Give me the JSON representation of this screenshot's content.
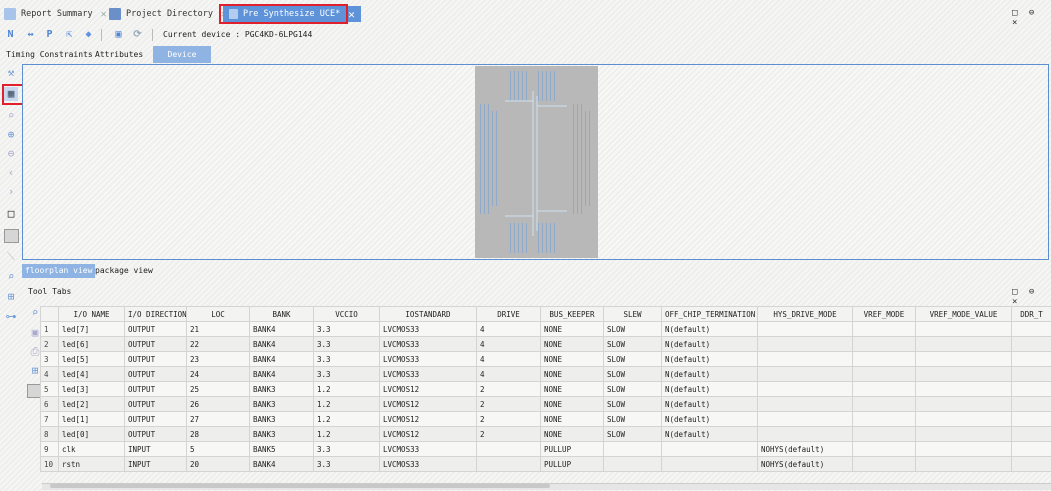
{
  "doc_tabs": [
    {
      "label": "Report Summary",
      "active": false
    },
    {
      "label": "Project Directory",
      "active": false
    },
    {
      "label": "Pre Synthesize UCE*",
      "active": true
    }
  ],
  "window_controls": "□ ⊖ ×",
  "toolbar": {
    "icons": [
      "new-icon",
      "arrow-icon",
      "p-icon",
      "export-icon",
      "diamond-icon",
      "save-icon",
      "refresh-icon"
    ],
    "current_device_label": "Current device : PGC4KD-6LPG144"
  },
  "view_tabs": [
    "Timing Constraints",
    "Attributes",
    "Device"
  ],
  "bottom_tabs": [
    "floorplan view",
    "package view"
  ],
  "tool_tabs_title": "Tool Tabs",
  "table": {
    "columns": [
      "",
      "I/O NAME",
      "I/O DIRECTION",
      "LOC",
      "BANK",
      "VCCIO",
      "IOSTANDARD",
      "DRIVE",
      "BUS_KEEPER",
      "SLEW",
      "OFF_CHIP_TERMINATION",
      "HYS_DRIVE_MODE",
      "VREF_MODE",
      "VREF_MODE_VALUE",
      "DDR_T"
    ],
    "rows": [
      [
        "1",
        "led[7]",
        "OUTPUT",
        "21",
        "BANK4",
        "3.3",
        "LVCMOS33",
        "4",
        "NONE",
        "SLOW",
        "N(default)",
        "",
        "",
        "",
        ""
      ],
      [
        "2",
        "led[6]",
        "OUTPUT",
        "22",
        "BANK4",
        "3.3",
        "LVCMOS33",
        "4",
        "NONE",
        "SLOW",
        "N(default)",
        "",
        "",
        "",
        ""
      ],
      [
        "3",
        "led[5]",
        "OUTPUT",
        "23",
        "BANK4",
        "3.3",
        "LVCMOS33",
        "4",
        "NONE",
        "SLOW",
        "N(default)",
        "",
        "",
        "",
        ""
      ],
      [
        "4",
        "led[4]",
        "OUTPUT",
        "24",
        "BANK4",
        "3.3",
        "LVCMOS33",
        "4",
        "NONE",
        "SLOW",
        "N(default)",
        "",
        "",
        "",
        ""
      ],
      [
        "5",
        "led[3]",
        "OUTPUT",
        "25",
        "BANK3",
        "1.2",
        "LVCMOS12",
        "2",
        "NONE",
        "SLOW",
        "N(default)",
        "",
        "",
        "",
        ""
      ],
      [
        "6",
        "led[2]",
        "OUTPUT",
        "26",
        "BANK3",
        "1.2",
        "LVCMOS12",
        "2",
        "NONE",
        "SLOW",
        "N(default)",
        "",
        "",
        "",
        ""
      ],
      [
        "7",
        "led[1]",
        "OUTPUT",
        "27",
        "BANK3",
        "1.2",
        "LVCMOS12",
        "2",
        "NONE",
        "SLOW",
        "N(default)",
        "",
        "",
        "",
        ""
      ],
      [
        "8",
        "led[0]",
        "OUTPUT",
        "28",
        "BANK3",
        "1.2",
        "LVCMOS12",
        "2",
        "NONE",
        "SLOW",
        "N(default)",
        "",
        "",
        "",
        ""
      ],
      [
        "9",
        "clk",
        "INPUT",
        "5",
        "BANK5",
        "3.3",
        "LVCMOS33",
        "",
        "PULLUP",
        "",
        "",
        "NOHYS(default)",
        "",
        "",
        ""
      ],
      [
        "10",
        "rstn",
        "INPUT",
        "20",
        "BANK4",
        "3.3",
        "LVCMOS33",
        "",
        "PULLUP",
        "",
        "",
        "NOHYS(default)",
        "",
        "",
        ""
      ]
    ]
  },
  "colors": {
    "accent": "#5e93d9",
    "highlight_box": "#e0202c",
    "chip": "#b8b8b8"
  }
}
